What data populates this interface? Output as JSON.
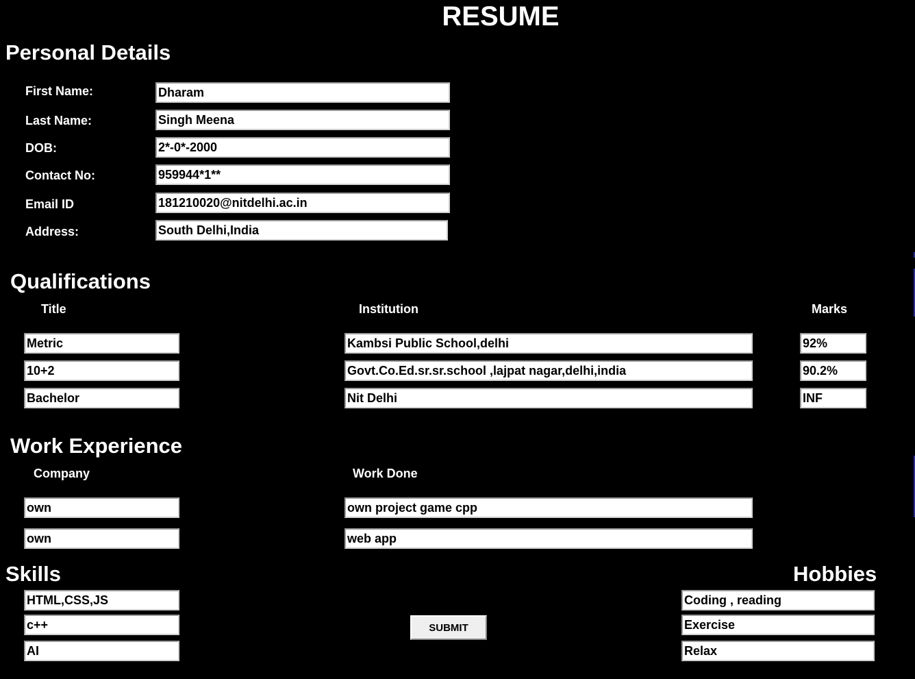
{
  "page_title": "RESUME",
  "personal": {
    "heading": "Personal Details",
    "fields": [
      {
        "label": "First Name:",
        "value": "Dharam"
      },
      {
        "label": "Last Name:",
        "value": "Singh Meena"
      },
      {
        "label": "DOB:",
        "value": "2*-0*-2000"
      },
      {
        "label": "Contact No:",
        "value": "959944*1**"
      },
      {
        "label": "Email ID",
        "value": "181210020@nitdelhi.ac.in"
      },
      {
        "label": "Address:",
        "value": "South Delhi,India"
      }
    ]
  },
  "qualifications": {
    "heading": "Qualifications",
    "columns": {
      "title": "Title",
      "institution": "Institution",
      "marks": "Marks"
    },
    "rows": [
      {
        "title": "Metric",
        "institution": "Kambsi Public School,delhi",
        "marks": "92%"
      },
      {
        "title": "10+2",
        "institution": "Govt.Co.Ed.sr.sr.school ,lajpat nagar,delhi,india",
        "marks": "90.2%"
      },
      {
        "title": "Bachelor",
        "institution": "Nit Delhi",
        "marks": "INF"
      }
    ]
  },
  "work": {
    "heading": "Work Experience",
    "columns": {
      "company": "Company",
      "work_done": "Work Done"
    },
    "rows": [
      {
        "company": "own",
        "work_done": "own project game cpp"
      },
      {
        "company": "own",
        "work_done": "web app"
      }
    ]
  },
  "skills": {
    "heading": "Skills",
    "items": [
      "HTML,CSS,JS",
      "c++",
      "AI"
    ]
  },
  "hobbies": {
    "heading": "Hobbies",
    "items": [
      "Coding , reading",
      "Exercise",
      "Relax"
    ]
  },
  "submit_label": "SUBMIT",
  "colors": {
    "background": "#000000",
    "text": "#ffffff",
    "field_bg": "#ffffff",
    "button_bg": "#efefef"
  }
}
